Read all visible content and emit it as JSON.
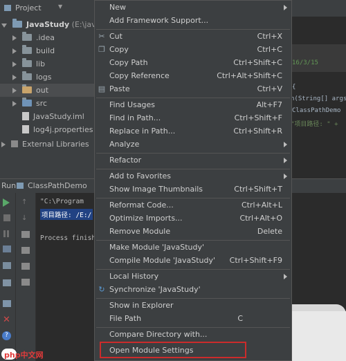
{
  "project_panel": {
    "title": "Project",
    "root": {
      "name": "JavaStudy",
      "path": "(E:\\java\\"
    },
    "items": [
      {
        "name": ".idea",
        "type": "folder"
      },
      {
        "name": "build",
        "type": "folder"
      },
      {
        "name": "lib",
        "type": "folder"
      },
      {
        "name": "logs",
        "type": "folder"
      },
      {
        "name": "out",
        "type": "folder"
      },
      {
        "name": "src",
        "type": "folder"
      },
      {
        "name": "JavaStudy.iml",
        "type": "file"
      },
      {
        "name": "log4j.properties",
        "type": "file"
      },
      {
        "name": "External Libraries",
        "type": "libs"
      }
    ]
  },
  "editor_peek": {
    "date": "16/3/15",
    "brace": "{",
    "line1": "n(String[] args",
    "line2": "ClassPathDemo",
    "line3": "\"项目路径: \" +"
  },
  "run_panel": {
    "tab_label": "Run",
    "config_name": "ClassPathDemo",
    "console": {
      "line1": "\"C:\\Program",
      "line2": "项目路径: /E:/",
      "line3": "Process finish"
    }
  },
  "context_menu": {
    "items": [
      {
        "label": "New",
        "shortcut": "",
        "submenu": true
      },
      {
        "label": "Add Framework Support...",
        "shortcut": "",
        "submenu": false
      },
      {
        "label": "Cut",
        "shortcut": "Ctrl+X",
        "submenu": false,
        "icon": "scissors-icon"
      },
      {
        "label": "Copy",
        "shortcut": "Ctrl+C",
        "submenu": false,
        "icon": "copy-icon"
      },
      {
        "label": "Copy Path",
        "shortcut": "Ctrl+Shift+C",
        "submenu": false
      },
      {
        "label": "Copy Reference",
        "shortcut": "Ctrl+Alt+Shift+C",
        "submenu": false
      },
      {
        "label": "Paste",
        "shortcut": "Ctrl+V",
        "submenu": false,
        "icon": "paste-icon"
      },
      {
        "label": "Find Usages",
        "shortcut": "Alt+F7",
        "submenu": false
      },
      {
        "label": "Find in Path...",
        "shortcut": "Ctrl+Shift+F",
        "submenu": false
      },
      {
        "label": "Replace in Path...",
        "shortcut": "Ctrl+Shift+R",
        "submenu": false
      },
      {
        "label": "Analyze",
        "shortcut": "",
        "submenu": true
      },
      {
        "label": "Refactor",
        "shortcut": "",
        "submenu": true
      },
      {
        "label": "Add to Favorites",
        "shortcut": "",
        "submenu": true
      },
      {
        "label": "Show Image Thumbnails",
        "shortcut": "Ctrl+Shift+T",
        "submenu": false
      },
      {
        "label": "Reformat Code...",
        "shortcut": "Ctrl+Alt+L",
        "submenu": false
      },
      {
        "label": "Optimize Imports...",
        "shortcut": "Ctrl+Alt+O",
        "submenu": false
      },
      {
        "label": "Remove Module",
        "shortcut": "Delete",
        "submenu": false
      },
      {
        "label": "Make Module 'JavaStudy'",
        "shortcut": "",
        "submenu": false
      },
      {
        "label": "Compile Module 'JavaStudy'",
        "shortcut": "Ctrl+Shift+F9",
        "submenu": false
      },
      {
        "label": "Local History",
        "shortcut": "",
        "submenu": true
      },
      {
        "label": "Synchronize 'JavaStudy'",
        "shortcut": "",
        "submenu": false,
        "icon": "sync-icon"
      },
      {
        "label": "Show in Explorer",
        "shortcut": "",
        "submenu": false
      },
      {
        "label": "File Path",
        "shortcut": "C",
        "submenu": false
      },
      {
        "label": "Compare Directory with...",
        "shortcut": "",
        "submenu": false
      },
      {
        "label": "Open Module Settings",
        "shortcut": "",
        "submenu": false
      }
    ]
  },
  "watermark": {
    "text": "php中文网"
  }
}
